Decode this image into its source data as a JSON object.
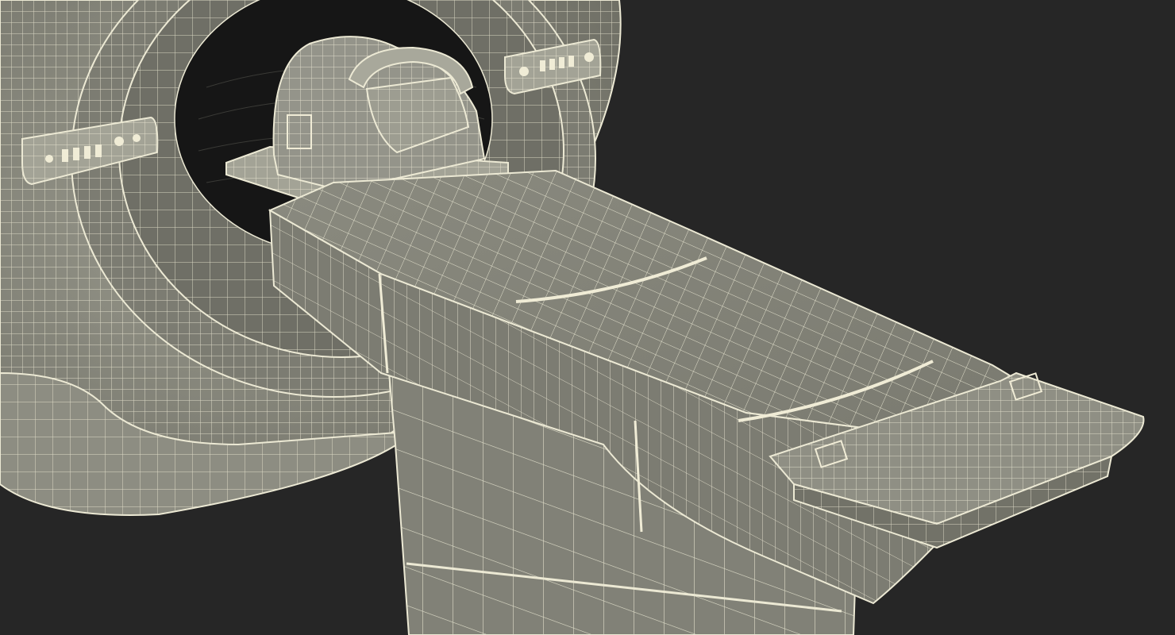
{
  "scene": {
    "subject": "ct-scanner-wireframe",
    "render_style": "wireframe",
    "colors": {
      "background": "#262626",
      "surface": "#8b8b80",
      "surface_dark": "#6c6c63",
      "surface_light": "#a3a396",
      "tunnel": "#161616",
      "wire": "#ece9d4",
      "wire_dim": "#d8d4bd"
    },
    "parts": [
      {
        "name": "gantry-ring"
      },
      {
        "name": "gantry-bore"
      },
      {
        "name": "control-panel-left"
      },
      {
        "name": "control-panel-right"
      },
      {
        "name": "head-cradle"
      },
      {
        "name": "patient-table"
      },
      {
        "name": "table-pedestal"
      },
      {
        "name": "table-end-handle"
      }
    ]
  }
}
